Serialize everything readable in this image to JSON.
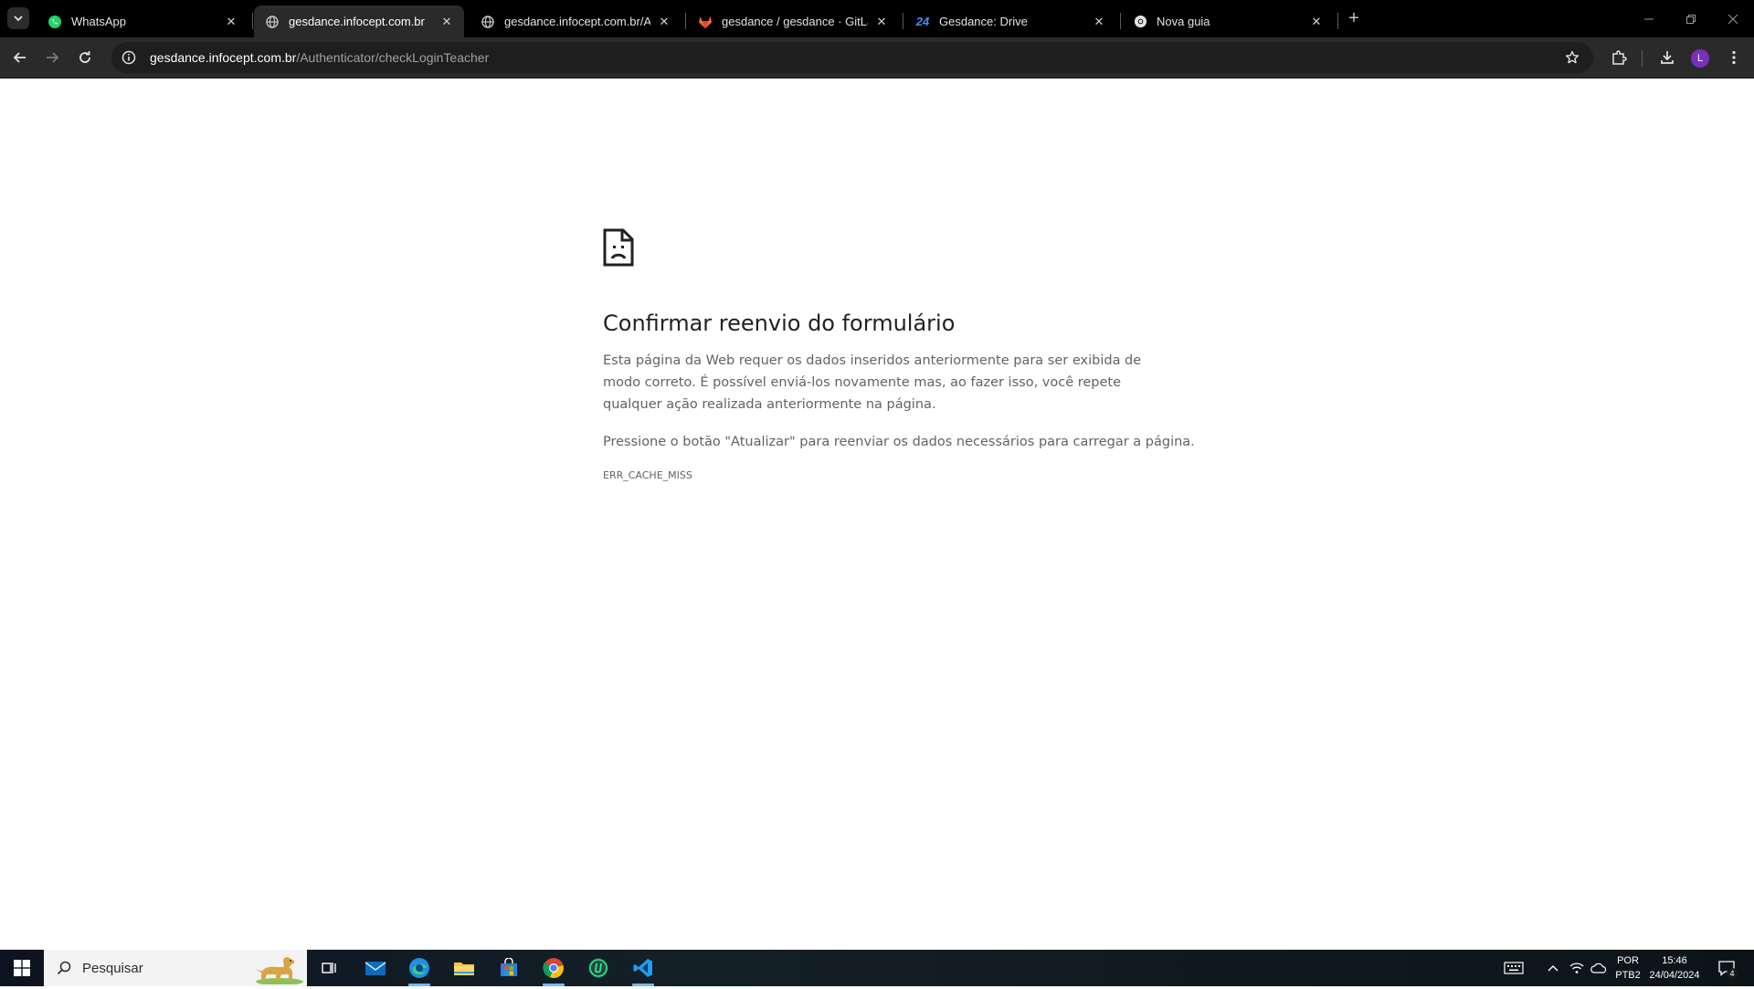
{
  "browser": {
    "tabs": [
      {
        "title": "WhatsApp",
        "favicon": "whatsapp-icon",
        "active": false
      },
      {
        "title": "gesdance.infocept.com.br",
        "favicon": "globe-icon",
        "active": true
      },
      {
        "title": "gesdance.infocept.com.br/Auth",
        "favicon": "globe-icon",
        "active": false
      },
      {
        "title": "gesdance / gesdance · GitLab",
        "favicon": "gitlab-icon",
        "active": false
      },
      {
        "title": "Gesdance: Drive",
        "favicon": "drive24-icon",
        "active": false
      },
      {
        "title": "Nova guia",
        "favicon": "chrome-icon",
        "active": false
      }
    ],
    "drive_badge": "24",
    "address": {
      "host": "gesdance.infocept.com.br",
      "path": "/Authenticator/checkLoginTeacher"
    },
    "profile_initial": "L"
  },
  "page": {
    "title": "Confirmar reenvio do formulário",
    "paragraph1": "Esta página da Web requer os dados inseridos anteriormente para ser exibida de modo correto. É possível enviá-los novamente mas, ao fazer isso, você repete qualquer ação realizada anteriormente na página.",
    "paragraph2": "Pressione o botão \"Atualizar\" para reenviar os dados necessários para carregar a página.",
    "error_code": "ERR_CACHE_MISS"
  },
  "taskbar": {
    "search_placeholder": "Pesquisar",
    "apps": [
      "task-view-icon",
      "mail-icon",
      "edge-icon",
      "file-explorer-icon",
      "store-icon",
      "chrome-icon",
      "upwork-icon",
      "vscode-icon"
    ],
    "language": "POR",
    "layout": "PTB2",
    "time": "15:46",
    "date": "24/04/2024",
    "notification_count": "4"
  },
  "colors": {
    "tabstrip": "#000000",
    "toolbar": "#2a2a2a",
    "omnibox": "#1e1e1e",
    "accent_taskbar": "#76b9ed",
    "avatar": "#7b2fbf"
  }
}
